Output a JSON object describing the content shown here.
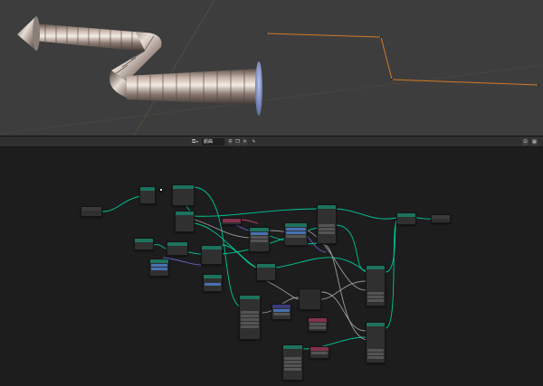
{
  "editor": {
    "node_tree_name": "颜曲",
    "editor_type_icon": "geometry-nodes-icon",
    "fake_user_icon": "shield-icon",
    "new_icon": "copy-icon",
    "delete_icon": "close-icon",
    "pin_icon": "pin-icon",
    "view_buttons": [
      "⊡",
      "▦"
    ]
  },
  "colors": {
    "viewport_bg": "#3d3d3d",
    "editor_bg": "#1d1d1d",
    "geometry_head": "#1d725e",
    "converter_head": "#246283",
    "vector_head": "#3b3b79",
    "input_head": "#83314a",
    "link_geometry": "#00d6a3",
    "link_float": "#a1a1a1",
    "link_vector": "#6363c7",
    "curve_line": "#e88a2b",
    "axis_x": "#8a4040",
    "axis_y": "#6f8a34"
  },
  "nodes": [
    {
      "id": "n01",
      "head": "",
      "type": "plain",
      "rows": [
        "",
        ""
      ]
    },
    {
      "id": "n02",
      "head": "",
      "type": "geometry",
      "rows": [
        "",
        "",
        "",
        ""
      ]
    },
    {
      "id": "n03",
      "head": "",
      "type": "geometry",
      "rows": [
        "",
        "",
        "",
        ""
      ]
    },
    {
      "id": "n04",
      "head": "",
      "type": "geometry",
      "rows": [
        "",
        "",
        "",
        "",
        ""
      ]
    },
    {
      "id": "n05",
      "head": "",
      "type": "input",
      "rows": [
        "",
        ""
      ]
    },
    {
      "id": "n06",
      "head": "",
      "type": "geometry",
      "rows": [
        "",
        "",
        ""
      ]
    },
    {
      "id": "n07",
      "head": "",
      "type": "geometry",
      "rows": [
        "",
        "",
        ""
      ]
    },
    {
      "id": "n08",
      "head": "",
      "type": "vector",
      "rows": [
        "",
        "",
        ""
      ]
    },
    {
      "id": "n09",
      "head": "",
      "type": "geometry",
      "rows": [
        "",
        "",
        "",
        ""
      ]
    },
    {
      "id": "n10",
      "head": "",
      "type": "geometry",
      "rows": [
        "",
        "",
        "",
        ""
      ]
    },
    {
      "id": "n11",
      "head": "",
      "type": "geometry",
      "rows": [
        "",
        "",
        "",
        "",
        "",
        ""
      ]
    },
    {
      "id": "n12",
      "head": "",
      "type": "vector",
      "rows": [
        "",
        "",
        "",
        ""
      ]
    },
    {
      "id": "n13",
      "head": "",
      "type": "geometry",
      "rows": [
        "",
        "",
        ""
      ]
    },
    {
      "id": "n14",
      "head": "",
      "type": "geometry",
      "rows": [
        "",
        "",
        "",
        "",
        "",
        "",
        "",
        ""
      ]
    },
    {
      "id": "n15",
      "head": "",
      "type": "geometry",
      "rows": [
        "",
        ""
      ]
    },
    {
      "id": "n16",
      "head": "",
      "type": "plain",
      "rows": [
        "",
        ""
      ]
    },
    {
      "id": "n17",
      "head": "",
      "type": "geometry",
      "rows": [
        "",
        "",
        "",
        "",
        "",
        "",
        "",
        "",
        ""
      ]
    },
    {
      "id": "n18",
      "head": "",
      "type": "geometry",
      "rows": [
        "",
        "",
        "",
        "",
        "",
        "",
        "",
        "",
        ""
      ]
    },
    {
      "id": "n19",
      "head": "",
      "type": "vector",
      "rows": [
        "",
        "",
        ""
      ]
    },
    {
      "id": "n20",
      "head": "",
      "type": "converter",
      "rows": [
        "",
        "",
        "",
        ""
      ]
    },
    {
      "id": "n21",
      "head": "",
      "type": "input",
      "rows": [
        "",
        ""
      ]
    },
    {
      "id": "n22",
      "head": "",
      "type": "geometry",
      "rows": [
        "",
        "",
        "",
        "",
        "",
        "",
        "",
        "",
        ""
      ]
    },
    {
      "id": "n23",
      "head": "",
      "type": "geometry",
      "rows": [
        "",
        "",
        "",
        "",
        "",
        "",
        "",
        ""
      ]
    },
    {
      "id": "n24",
      "head": "",
      "type": "input",
      "rows": [
        "",
        "",
        ""
      ]
    },
    {
      "id": "n25",
      "head": "",
      "type": "geometry",
      "rows": [
        "",
        "",
        "",
        "",
        "",
        ""
      ]
    }
  ]
}
